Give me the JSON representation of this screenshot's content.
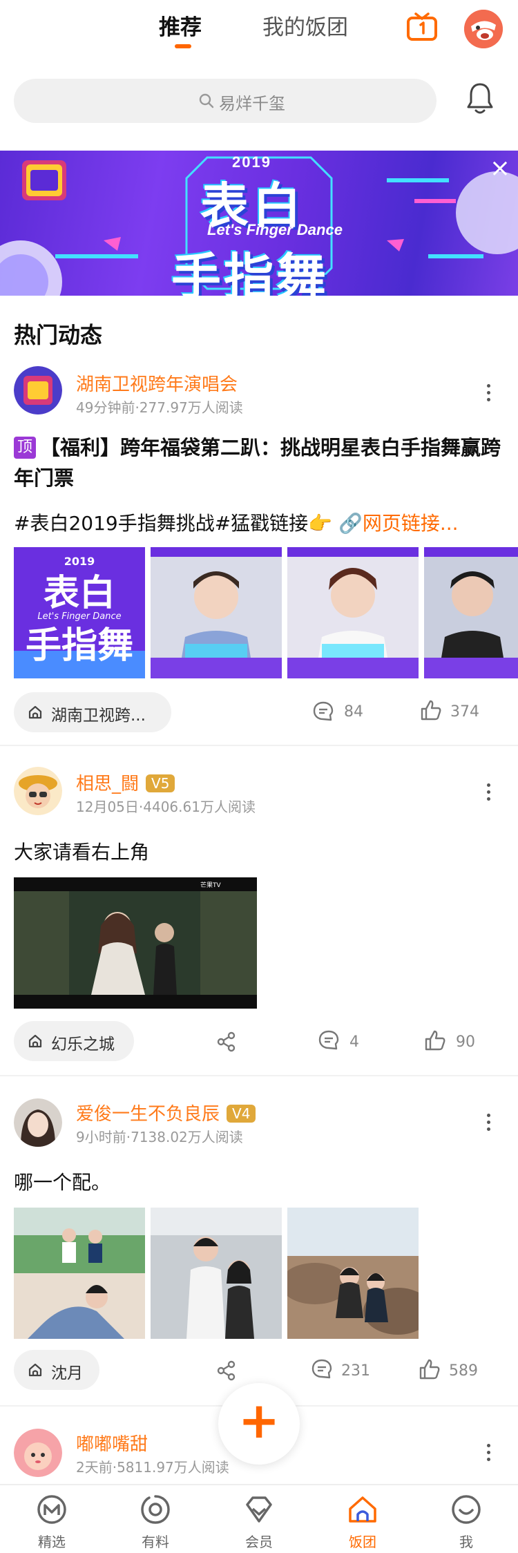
{
  "header": {
    "tab_recommend": "推荐",
    "tab_my_group": "我的饭团"
  },
  "search": {
    "placeholder": "易烊千玺"
  },
  "banner": {
    "year": "2019",
    "title_line1": "表白",
    "title_subtitle": "Let's Finger Dance",
    "title_line2": "手指舞",
    "close": "×"
  },
  "section": {
    "title": "热门动态"
  },
  "posts": [
    {
      "author": "湖南卫视跨年演唱会",
      "meta": "49分钟前·277.97万人阅读",
      "top_tag": "顶",
      "title": "【福利】跨年福袋第二趴：挑战明星表白手指舞赢跨年门票",
      "body_text": "#表白2019手指舞挑战#猛戳链接👉",
      "link_text": "网页链接...",
      "group": "湖南卫视跨...",
      "comments": "84",
      "likes": "374"
    },
    {
      "author": "相思_闘",
      "badge": "V5",
      "meta": "12月05日·4406.61万人阅读",
      "body_text": "大家请看右上角",
      "group": "幻乐之城",
      "comments": "4",
      "likes": "90"
    },
    {
      "author": "爱俊一生不负良辰",
      "badge": "V4",
      "meta": "9小时前·7138.02万人阅读",
      "body_text": "哪一个配。",
      "group": "沈月",
      "comments": "231",
      "likes": "589"
    },
    {
      "author": "嘟嘟嘴甜",
      "meta": "2天前·5811.97万人阅读"
    }
  ],
  "fab": {
    "label": "+"
  },
  "nav": [
    {
      "label": "精选",
      "icon": "m-circle-icon"
    },
    {
      "label": "有料",
      "icon": "eye-icon"
    },
    {
      "label": "会员",
      "icon": "diamond-icon"
    },
    {
      "label": "饭团",
      "icon": "home-icon"
    },
    {
      "label": "我",
      "icon": "smile-icon"
    }
  ],
  "colors": {
    "accent": "#ff6600",
    "author": "#ff7a1a",
    "vbadge": "#e0a83a",
    "top_tag": "#9b39d6",
    "banner": "#6a2fe0"
  }
}
